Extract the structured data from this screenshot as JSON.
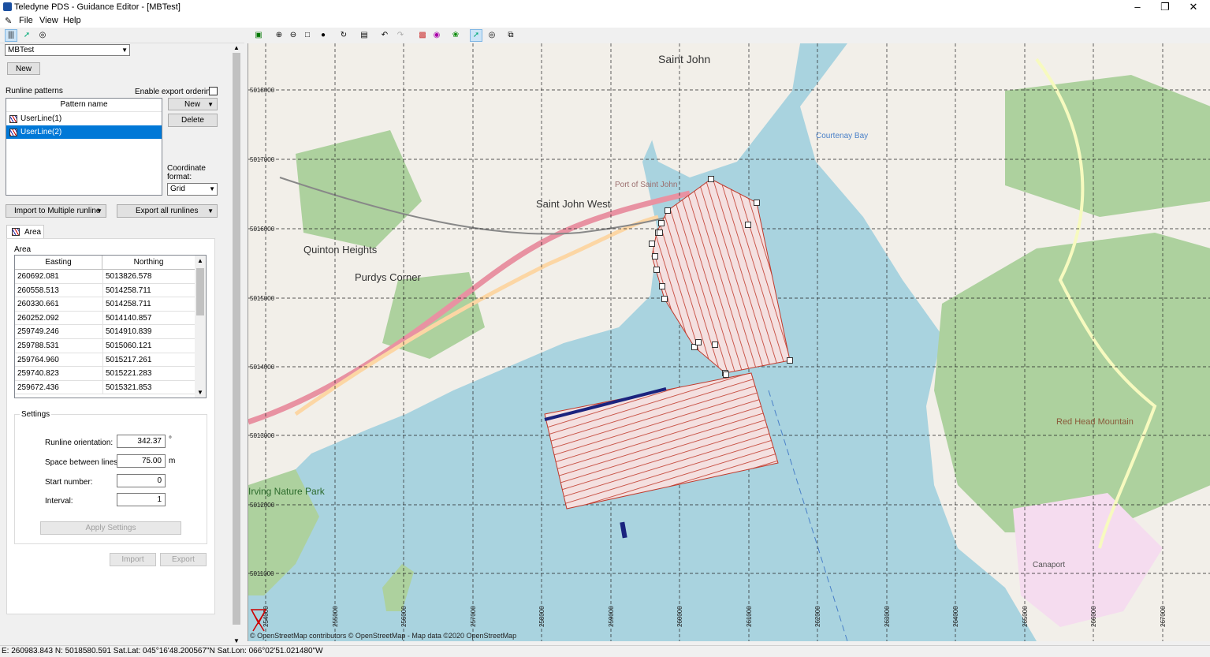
{
  "window": {
    "title": "Teledyne PDS - Guidance Editor - [MBTest]"
  },
  "menu": [
    "File",
    "View",
    "Help"
  ],
  "project_select": {
    "value": "MBTest"
  },
  "new_button": "New",
  "runline_patterns": {
    "label": "Runline patterns",
    "enable_export_ordering": "Enable export ordering",
    "header": "Pattern name",
    "items": [
      "UserLine(1)",
      "UserLine(2)"
    ],
    "selected": 1,
    "new_label": "New",
    "delete_label": "Delete",
    "coord_format_label": "Coordinate format:",
    "coord_format_value": "Grid"
  },
  "import_multiple": "Import to Multiple runline",
  "export_all": "Export all runlines",
  "tab": {
    "label": "Area"
  },
  "area": {
    "label": "Area",
    "columns": [
      "Easting",
      "Northing"
    ],
    "rows": [
      [
        "260692.081",
        "5013826.578"
      ],
      [
        "260558.513",
        "5014258.711"
      ],
      [
        "260330.661",
        "5014258.711"
      ],
      [
        "260252.092",
        "5014140.857"
      ],
      [
        "259749.246",
        "5014910.839"
      ],
      [
        "259788.531",
        "5015060.121"
      ],
      [
        "259764.960",
        "5015217.261"
      ],
      [
        "259740.823",
        "5015221.283"
      ],
      [
        "259672.436",
        "5015321.853"
      ]
    ]
  },
  "settings": {
    "label": "Settings",
    "orientation_label": "Runline orientation:",
    "orientation_value": "342.37",
    "orientation_unit": "°",
    "spacing_label": "Space between lines:",
    "spacing_value": "75.00",
    "spacing_unit": "m",
    "start_label": "Start number:",
    "start_value": "0",
    "interval_label": "Interval:",
    "interval_value": "1",
    "apply": "Apply Settings",
    "import": "Import",
    "export": "Export"
  },
  "map": {
    "place_labels": [
      "Saint John",
      "Saint John West",
      "Quinton Heights",
      "Purdys Corner",
      "Port of Saint John",
      "Red Head Mountain",
      "Irving Nature Park",
      "Courtenay Bay",
      "Canaport"
    ],
    "northing_labels": [
      "5018000",
      "5017000",
      "5016000",
      "5015000",
      "5014000",
      "5013000",
      "5012000",
      "5011000"
    ],
    "easting_labels": [
      "254000",
      "255000",
      "256000",
      "257000",
      "258000",
      "259000",
      "260000",
      "261000",
      "262000",
      "263000",
      "264000",
      "265000",
      "266000",
      "267000"
    ],
    "attribution": "© OpenStreetMap contributors © OpenStreetMap - Map data ©2020 OpenStreetMap",
    "colors": {
      "water": "#a9d3df",
      "land": "#f2efe9",
      "park": "#add19e",
      "runline": "#c0392b",
      "selected": "#1a237e"
    }
  },
  "status": "E: 260983.843 N: 5018580.591 Sat.Lat: 045°16'48.200567\"N Sat.Lon: 066°02'51.021480\"W"
}
